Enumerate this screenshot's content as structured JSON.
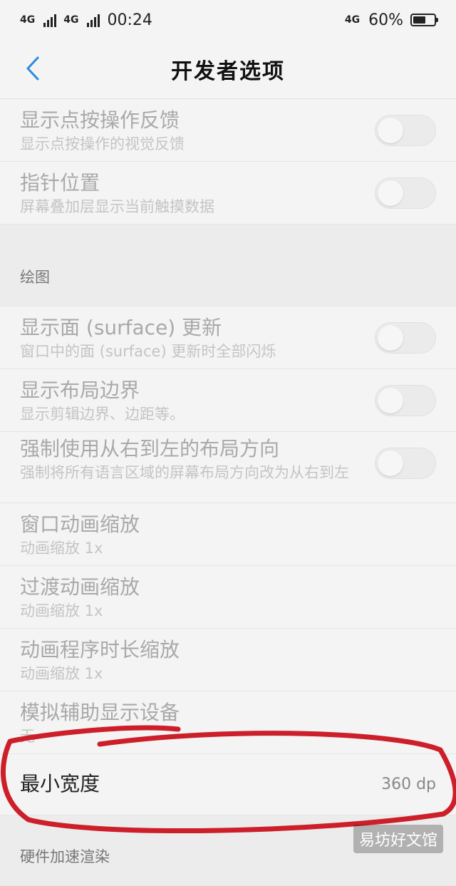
{
  "status_bar": {
    "net1": "4G",
    "net2": "4G",
    "time": "00:24",
    "net_right": "4G",
    "battery": "60%",
    "battery_level": 0.6
  },
  "header": {
    "title": "开发者选项"
  },
  "rows_top": [
    {
      "title": "显示点按操作反馈",
      "sub": "显示点按操作的视觉反馈"
    },
    {
      "title": "指针位置",
      "sub": "屏幕叠加层显示当前触摸数据"
    }
  ],
  "section_drawing": {
    "label": "绘图"
  },
  "rows_draw": [
    {
      "title": "显示面 (surface) 更新",
      "sub": "窗口中的面 (surface) 更新时全部闪烁"
    },
    {
      "title": "显示布局边界",
      "sub": "显示剪辑边界、边距等。"
    },
    {
      "title": "强制使用从右到左的布局方向",
      "sub": "强制将所有语言区域的屏幕布局方向改为从右到左"
    },
    {
      "title": "窗口动画缩放",
      "sub": "动画缩放 1x"
    },
    {
      "title": "过渡动画缩放",
      "sub": "动画缩放 1x"
    },
    {
      "title": "动画程序时长缩放",
      "sub": "动画缩放 1x"
    },
    {
      "title": "模拟辅助显示设备",
      "sub": "无"
    }
  ],
  "min_width": {
    "title": "最小宽度",
    "value": "360 dp"
  },
  "section_hw": {
    "label": "硬件加速渲染"
  },
  "watermark": "易坊好文馆",
  "colors": {
    "annotation": "#cc1f2a",
    "accent": "#2b8ae0"
  }
}
